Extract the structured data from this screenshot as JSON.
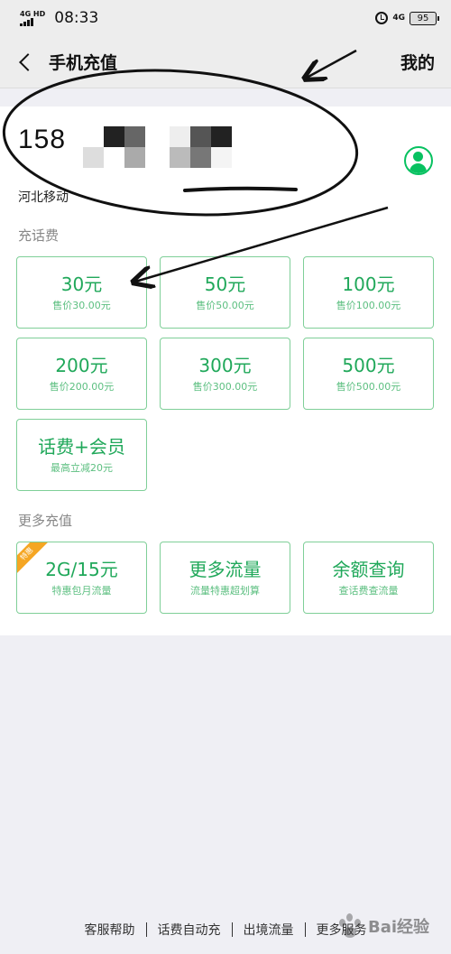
{
  "status_bar": {
    "network_left": "4G HD",
    "time": "08:33",
    "network_right": "4G",
    "battery": "95"
  },
  "nav": {
    "title": "手机充值",
    "mine": "我的"
  },
  "account": {
    "phone_prefix": "158",
    "carrier": "河北移动"
  },
  "sections": {
    "topup_label": "充话费",
    "more_label": "更多充值"
  },
  "topup_options": [
    {
      "amount": "30元",
      "price": "售价30.00元"
    },
    {
      "amount": "50元",
      "price": "售价50.00元"
    },
    {
      "amount": "100元",
      "price": "售价100.00元"
    },
    {
      "amount": "200元",
      "price": "售价200.00元"
    },
    {
      "amount": "300元",
      "price": "售价300.00元"
    },
    {
      "amount": "500元",
      "price": "售价500.00元"
    },
    {
      "amount": "话费+会员",
      "price": "最高立减20元"
    }
  ],
  "more_options": [
    {
      "title": "2G/15元",
      "subtitle": "特惠包月流量",
      "badge": "特惠"
    },
    {
      "title": "更多流量",
      "subtitle": "流量特惠超划算"
    },
    {
      "title": "余额查询",
      "subtitle": "查话费查流量"
    }
  ],
  "bottom_links": [
    "客服帮助",
    "话费自动充",
    "出境流量",
    "更多服务"
  ],
  "watermark": "Bai经验",
  "colors": {
    "accent_green": "#20a85a",
    "card_border": "#7fcf98",
    "page_background": "#efeff4",
    "badge_orange": "#f5a623"
  }
}
